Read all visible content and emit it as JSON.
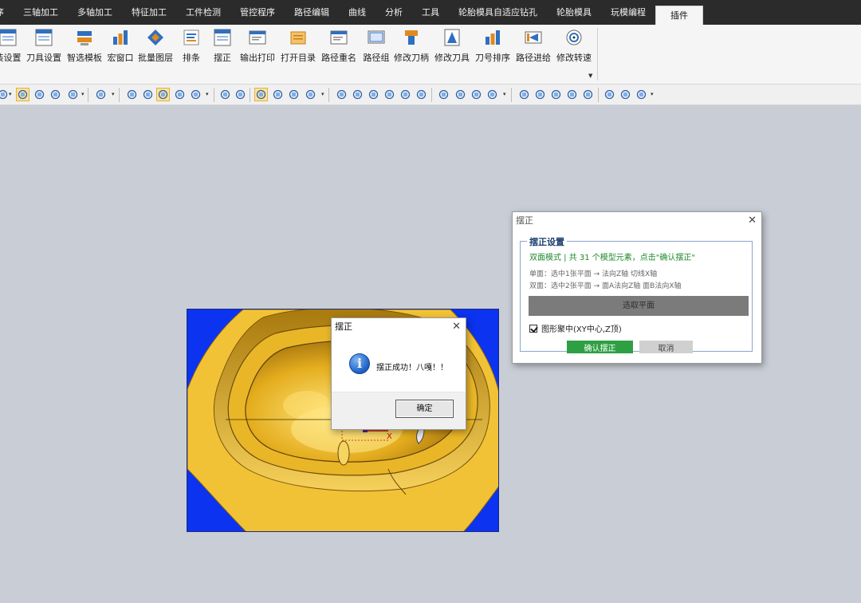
{
  "menu": {
    "items": [
      "序",
      "三轴加工",
      "多轴加工",
      "特征加工",
      "工件检测",
      "管控程序",
      "路径编辑",
      "曲线",
      "分析",
      "工具",
      "轮胎模具自适应钻孔",
      "轮胎模具",
      "玩模编程",
      "插件"
    ],
    "active_index": 13
  },
  "ribbon": {
    "buttons": [
      {
        "label": "装设置",
        "icon": "settings-doc-icon",
        "color": "#2f6fc0"
      },
      {
        "label": "刀具设置",
        "icon": "tool-settings-icon",
        "color": "#2f6fc0"
      },
      {
        "label": "智选模板",
        "icon": "template-icon",
        "color": "#e08a1e"
      },
      {
        "label": "宏窗口",
        "icon": "macro-window-icon",
        "color": "#2f6fc0"
      },
      {
        "label": "批量图层",
        "icon": "layers-icon",
        "color": "#2f6fc0"
      },
      {
        "label": "排条",
        "icon": "list-icon",
        "color": "#2f6fc0"
      },
      {
        "label": "摆正",
        "icon": "align-icon",
        "color": "#2f6fc0"
      },
      {
        "label": "输出打印",
        "icon": "print-icon",
        "color": "#2f6fc0"
      },
      {
        "label": "打开目录",
        "icon": "folder-icon",
        "color": "#e08a1e"
      },
      {
        "label": "路径重名",
        "icon": "rename-icon",
        "color": "#2f6fc0"
      },
      {
        "label": "路径组",
        "icon": "path-group-icon",
        "color": "#2f6fc0"
      },
      {
        "label": "修改刀柄",
        "icon": "holder-icon",
        "color": "#e08a1e"
      },
      {
        "label": "修改刀具",
        "icon": "tool-icon",
        "color": "#2f6fc0"
      },
      {
        "label": "刀号排序",
        "icon": "sort-icon",
        "color": "#2f6fc0"
      },
      {
        "label": "路径进给",
        "icon": "feed-icon",
        "color": "#2f6fc0"
      },
      {
        "label": "修改转速",
        "icon": "speed-icon",
        "color": "#2f6fc0"
      }
    ]
  },
  "message_box": {
    "title": "摆正",
    "text": "摆正成功！八嘎！！",
    "ok_label": "确定"
  },
  "settings_dialog": {
    "title": "摆正",
    "group_title": "摆正设置",
    "mode_line": "双面模式 | 共 31 个模型元素，点击\"确认摆正\"",
    "help_single": "单面：选中1张平面 → 法向Z轴 切线X轴",
    "help_double": "双面：选中2张平面 → 面A法向Z轴 面B法向X轴",
    "pick_plane_label": "选取平面",
    "center_checkbox_label": "图形聚中(XY中心,Z顶)",
    "center_checked": true,
    "confirm_label": "确认摆正",
    "cancel_label": "取消"
  },
  "viewport": {
    "axis_label": "X",
    "background_color": "#0b33f0",
    "part_color": "#f2c63c"
  }
}
